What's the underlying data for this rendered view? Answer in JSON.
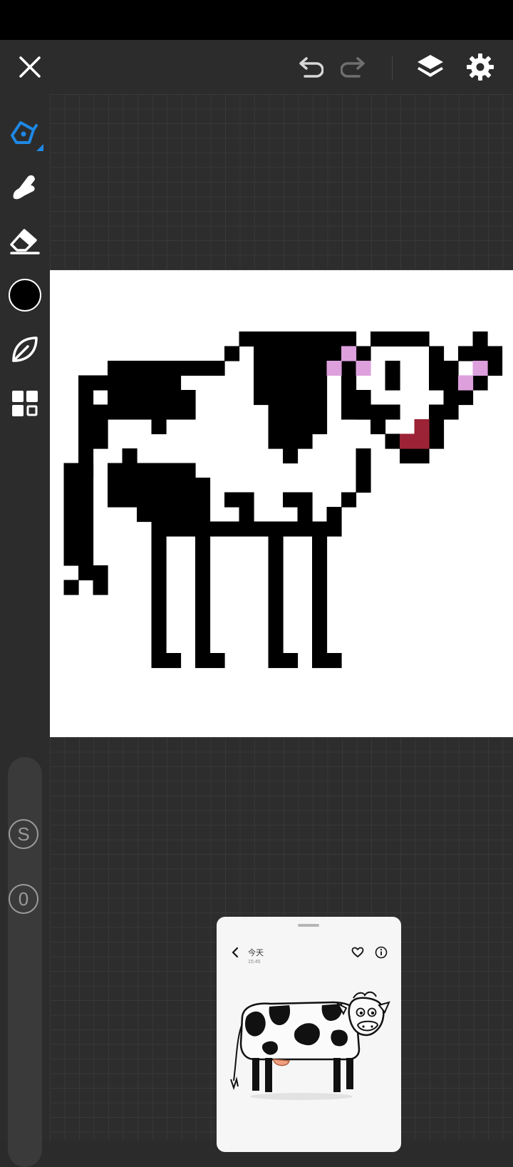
{
  "toolbar": {
    "close_icon": "close-icon",
    "undo_icon": "undo-icon",
    "redo_icon": "redo-icon",
    "layers_icon": "layers-icon",
    "settings_icon": "gear-icon"
  },
  "tools": [
    {
      "name": "pen",
      "icon": "pen-icon",
      "active": true
    },
    {
      "name": "smudge",
      "icon": "smudge-icon",
      "active": false
    },
    {
      "name": "eraser",
      "icon": "eraser-icon",
      "active": false
    },
    {
      "name": "color",
      "icon": "color-swatch",
      "active": false
    },
    {
      "name": "leaf",
      "icon": "leaf-icon",
      "active": false
    },
    {
      "name": "grid-menu",
      "icon": "grid-icon",
      "active": false
    }
  ],
  "colors": {
    "accent": "#1e88e5",
    "current_color": "#000000",
    "pixel_pink": "#dda0dd",
    "pixel_red": "#9b2335"
  },
  "badges": {
    "stabilizer": "S",
    "opacity": "0"
  },
  "reference": {
    "title": "今天",
    "time": "15:45",
    "image": "cow-photo"
  }
}
